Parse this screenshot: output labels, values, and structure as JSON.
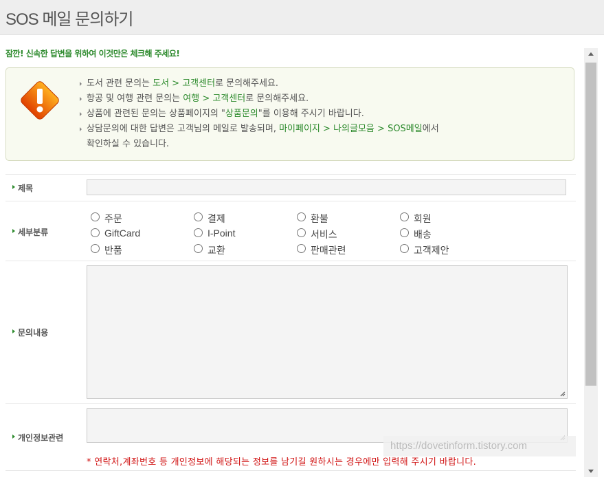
{
  "header": {
    "title": "SOS 메일 문의하기"
  },
  "notice": "잠깐! 신속한 답변을 위하여 이것만은 체크해 주세요!",
  "info": {
    "items": [
      {
        "pre": "도서 관련 문의는 ",
        "link1": "도서",
        "sep": " > ",
        "link2": "고객센터",
        "post": "로 문의해주세요."
      },
      {
        "pre": "항공 및 여행 관련 문의는 ",
        "link1": "여행",
        "sep": " > ",
        "link2": "고객센터",
        "post": "로 문의해주세요."
      },
      {
        "pre": "상품에 관련된 문의는 상품페이지의 \"",
        "link1": "상품문의",
        "post": "\"를 이용해 주시기 바랍니다."
      },
      {
        "pre": "상담문의에 대한 답변은 고객님의 메일로 발송되며, ",
        "link1": "마이페이지",
        "sep": " > ",
        "link2": "나의글모음",
        "sep2": " > ",
        "link3": "SOS메일",
        "post": "에서",
        "line2": "확인하실 수 있습니다."
      }
    ]
  },
  "form": {
    "subject_label": "제목",
    "category_label": "세부분류",
    "categories": [
      "주문",
      "결제",
      "환불",
      "회원",
      "GiftCard",
      "I-Point",
      "서비스",
      "배송",
      "반품",
      "교환",
      "판매관련",
      "고객제안"
    ],
    "content_label": "문의내용",
    "privacy_label": "개인정보관련",
    "privacy_warning": "* 연락처,계좌번호 등 개인정보에 해당되는 정보를 남기길 원하시는 경우에만 입력해 주시기 바랍니다."
  },
  "watermark": "https://dovetinform.tistory.com",
  "colors": {
    "accent_green": "#2e8b2e",
    "warning_red": "#d01010",
    "header_bg": "#eeeeee"
  }
}
